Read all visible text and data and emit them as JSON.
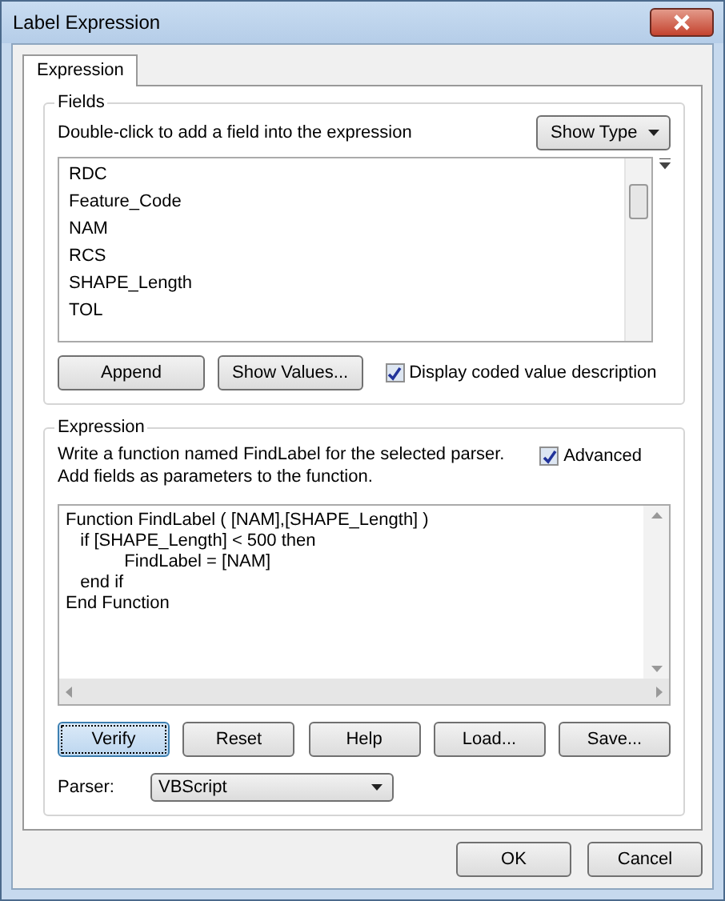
{
  "window": {
    "title": "Label Expression"
  },
  "tabs": [
    {
      "label": "Expression",
      "selected": true
    }
  ],
  "fields": {
    "title": "Fields",
    "hint": "Double-click to add a field into the expression",
    "show_type_button": "Show Type",
    "items": [
      "RDC",
      "Feature_Code",
      "NAM",
      "RCS",
      "SHAPE_Length",
      "TOL"
    ],
    "append_button": "Append",
    "show_values_button": "Show Values...",
    "display_coded": {
      "label": "Display coded value description",
      "checked": true
    }
  },
  "expression": {
    "title": "Expression",
    "instructions": [
      "Write a function named FindLabel for the selected parser.",
      "Add fields as parameters to the function."
    ],
    "advanced": {
      "label": "Advanced",
      "checked": true
    },
    "code_lines": [
      "Function FindLabel ( [NAM],[SHAPE_Length] )",
      "   if [SHAPE_Length] < 500 then",
      "            FindLabel = [NAM]",
      "   end if",
      "End Function"
    ],
    "buttons": [
      {
        "label": "Verify",
        "focused": true
      },
      {
        "label": "Reset",
        "focused": false
      },
      {
        "label": "Help",
        "focused": false
      },
      {
        "label": "Load...",
        "focused": false
      },
      {
        "label": "Save...",
        "focused": false
      }
    ],
    "parser_label": "Parser:",
    "parser_value": "VBScript"
  },
  "dialog_buttons": [
    "OK",
    "Cancel"
  ]
}
